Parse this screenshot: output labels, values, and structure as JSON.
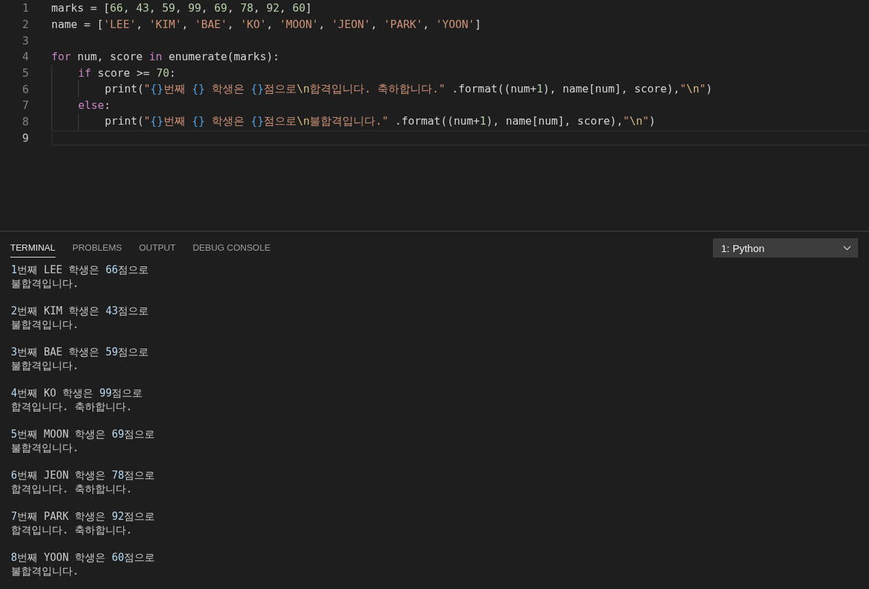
{
  "editor": {
    "lines": [
      {
        "number": "1",
        "current": false,
        "tokens": [
          {
            "kind": "plain",
            "text": "marks = ["
          },
          {
            "kind": "num",
            "text": "66"
          },
          {
            "kind": "plain",
            "text": ", "
          },
          {
            "kind": "num",
            "text": "43"
          },
          {
            "kind": "plain",
            "text": ", "
          },
          {
            "kind": "num",
            "text": "59"
          },
          {
            "kind": "plain",
            "text": ", "
          },
          {
            "kind": "num",
            "text": "99"
          },
          {
            "kind": "plain",
            "text": ", "
          },
          {
            "kind": "num",
            "text": "69"
          },
          {
            "kind": "plain",
            "text": ", "
          },
          {
            "kind": "num",
            "text": "78"
          },
          {
            "kind": "plain",
            "text": ", "
          },
          {
            "kind": "num",
            "text": "92"
          },
          {
            "kind": "plain",
            "text": ", "
          },
          {
            "kind": "num",
            "text": "60"
          },
          {
            "kind": "plain",
            "text": "]"
          }
        ]
      },
      {
        "number": "2",
        "current": false,
        "tokens": [
          {
            "kind": "plain",
            "text": "name = ["
          },
          {
            "kind": "str",
            "text": "'LEE'"
          },
          {
            "kind": "plain",
            "text": ", "
          },
          {
            "kind": "str",
            "text": "'KIM'"
          },
          {
            "kind": "plain",
            "text": ", "
          },
          {
            "kind": "str",
            "text": "'BAE'"
          },
          {
            "kind": "plain",
            "text": ", "
          },
          {
            "kind": "str",
            "text": "'KO'"
          },
          {
            "kind": "plain",
            "text": ", "
          },
          {
            "kind": "str",
            "text": "'MOON'"
          },
          {
            "kind": "plain",
            "text": ", "
          },
          {
            "kind": "str",
            "text": "'JEON'"
          },
          {
            "kind": "plain",
            "text": ", "
          },
          {
            "kind": "str",
            "text": "'PARK'"
          },
          {
            "kind": "plain",
            "text": ", "
          },
          {
            "kind": "str",
            "text": "'YOON'"
          },
          {
            "kind": "plain",
            "text": "]"
          }
        ]
      },
      {
        "number": "3",
        "current": false
      },
      {
        "number": "4",
        "current": false,
        "tokens": [
          {
            "kind": "kw",
            "text": "for"
          },
          {
            "kind": "plain",
            "text": " num, score "
          },
          {
            "kind": "kw",
            "text": "in"
          },
          {
            "kind": "plain",
            "text": " enumerate(marks):"
          }
        ],
        "children": [
          {
            "number": "5",
            "current": false,
            "tokens": [
              {
                "kind": "kw",
                "text": "if"
              },
              {
                "kind": "plain",
                "text": " score >= "
              },
              {
                "kind": "num",
                "text": "70"
              },
              {
                "kind": "plain",
                "text": ":"
              }
            ],
            "children": [
              {
                "number": "6",
                "current": false,
                "tokens": [
                  {
                    "kind": "plain",
                    "text": "print("
                  },
                  {
                    "kind": "str",
                    "text": "\""
                  },
                  {
                    "kind": "ph",
                    "text": "{}"
                  },
                  {
                    "kind": "str",
                    "text": "번째 "
                  },
                  {
                    "kind": "ph",
                    "text": "{}"
                  },
                  {
                    "kind": "str",
                    "text": " 학생은 "
                  },
                  {
                    "kind": "ph",
                    "text": "{}"
                  },
                  {
                    "kind": "str",
                    "text": "점으로"
                  },
                  {
                    "kind": "esc",
                    "text": "\\n"
                  },
                  {
                    "kind": "str",
                    "text": "합격입니다. 축하합니다.\""
                  },
                  {
                    "kind": "plain",
                    "text": " .format((num+"
                  },
                  {
                    "kind": "num",
                    "text": "1"
                  },
                  {
                    "kind": "plain",
                    "text": "), name[num], score),"
                  },
                  {
                    "kind": "str",
                    "text": "\""
                  },
                  {
                    "kind": "esc",
                    "text": "\\n"
                  },
                  {
                    "kind": "str",
                    "text": "\""
                  },
                  {
                    "kind": "plain",
                    "text": ")"
                  }
                ]
              }
            ]
          },
          {
            "number": "7",
            "current": false,
            "tokens": [
              {
                "kind": "kw",
                "text": "else"
              },
              {
                "kind": "plain",
                "text": ":"
              }
            ],
            "children": [
              {
                "number": "8",
                "current": false,
                "tokens": [
                  {
                    "kind": "plain",
                    "text": "print("
                  },
                  {
                    "kind": "str",
                    "text": "\""
                  },
                  {
                    "kind": "ph",
                    "text": "{}"
                  },
                  {
                    "kind": "str",
                    "text": "번째 "
                  },
                  {
                    "kind": "ph",
                    "text": "{}"
                  },
                  {
                    "kind": "str",
                    "text": " 학생은 "
                  },
                  {
                    "kind": "ph",
                    "text": "{}"
                  },
                  {
                    "kind": "str",
                    "text": "점으로"
                  },
                  {
                    "kind": "esc",
                    "text": "\\n"
                  },
                  {
                    "kind": "str",
                    "text": "불합격입니다.\""
                  },
                  {
                    "kind": "plain",
                    "text": " .format((num+"
                  },
                  {
                    "kind": "num",
                    "text": "1"
                  },
                  {
                    "kind": "plain",
                    "text": "), name[num], score),"
                  },
                  {
                    "kind": "str",
                    "text": "\""
                  },
                  {
                    "kind": "esc",
                    "text": "\\n"
                  },
                  {
                    "kind": "str",
                    "text": "\""
                  },
                  {
                    "kind": "plain",
                    "text": ")"
                  }
                ]
              }
            ]
          }
        ]
      },
      {
        "number": "9",
        "current": true
      }
    ]
  },
  "panel": {
    "tabs": [
      {
        "label": "TERMINAL",
        "selected": true
      },
      {
        "label": "PROBLEMS",
        "selected": false
      },
      {
        "label": "OUTPUT",
        "selected": false
      },
      {
        "label": "DEBUG CONSOLE",
        "selected": false
      }
    ],
    "terminal_select": {
      "value": "1: Python"
    },
    "terminal_output": [
      [
        "1",
        "번째 LEE 학생은 ",
        "66",
        "점으로",
        "불합격입니다."
      ],
      [
        "2",
        "번째 KIM 학생은 ",
        "43",
        "점으로",
        "불합격입니다."
      ],
      [
        "3",
        "번째 BAE 학생은 ",
        "59",
        "점으로",
        "불합격입니다."
      ],
      [
        "4",
        "번째 KO 학생은 ",
        "99",
        "점으로",
        "합격입니다. 축하합니다."
      ],
      [
        "5",
        "번째 MOON 학생은 ",
        "69",
        "점으로",
        "불합격입니다."
      ],
      [
        "6",
        "번째 JEON 학생은 ",
        "78",
        "점으로",
        "합격입니다. 축하합니다."
      ],
      [
        "7",
        "번째 PARK 학생은 ",
        "92",
        "점으로",
        "합격입니다. 축하합니다."
      ],
      [
        "8",
        "번째 YOON 학생은 ",
        "60",
        "점으로",
        "불합격입니다."
      ]
    ]
  }
}
